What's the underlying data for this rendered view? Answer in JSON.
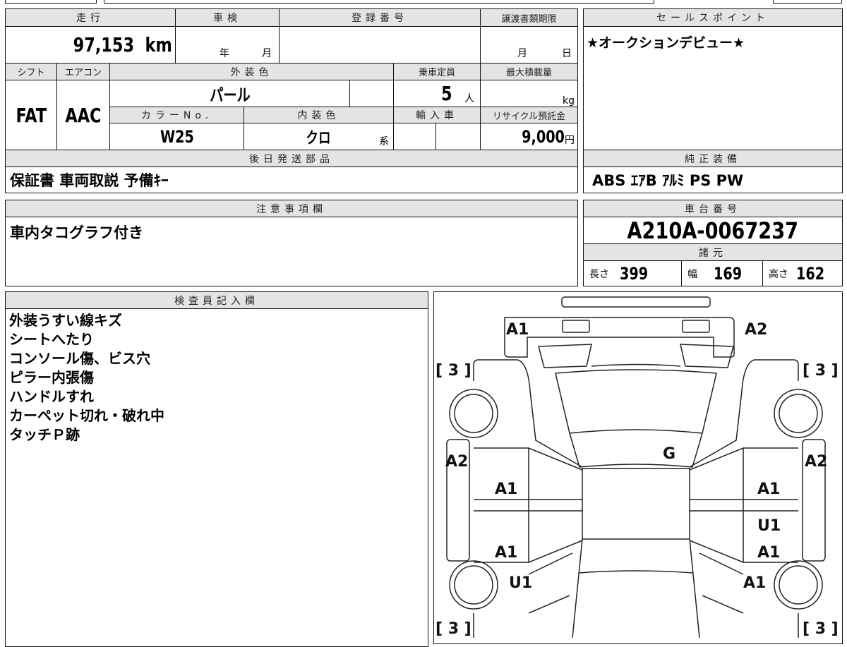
{
  "vehicle": {
    "mileage_label": "走行",
    "mileage": "97,153",
    "mileage_unit": "km",
    "inspection_label": "車検",
    "inspection_year": "年",
    "inspection_month": "月",
    "registration_label": "登録番号",
    "transfer_deadline_label": "譲渡書類期限",
    "transfer_month": "月",
    "transfer_day": "日",
    "shift_label": "シフト",
    "shift": "FAT",
    "aircon_label": "エアコン",
    "aircon": "AAC",
    "exterior_color_label": "外装色",
    "exterior_color": "パール",
    "capacity_label": "乗車定員",
    "capacity": "5",
    "capacity_unit": "人",
    "max_load_label": "最大積載量",
    "max_load_unit": "kg",
    "color_no_label": "カラーNo.",
    "color_no": "W25",
    "interior_color_label": "内装色",
    "interior_color": "クロ",
    "interior_suffix": "系",
    "import_label": "輸入車",
    "recycle_label": "リサイクル預託金",
    "recycle_fee": "9,000",
    "recycle_unit": "円"
  },
  "later_parts": {
    "label": "後日発送部品",
    "value": "保証書 車両取説 予備ｷｰ"
  },
  "sales_point": {
    "label": "セールスポイント",
    "value": "★オークションデビュー★"
  },
  "equipment": {
    "label": "純正装備",
    "value": "ABS ｴｱB ｱﾙﾐ PS PW"
  },
  "notes": {
    "label": "注意事項欄",
    "value": "車内タコグラフ付き"
  },
  "chassis": {
    "label": "車台番号",
    "value": "A210A-0067237"
  },
  "specs": {
    "label": "諸元",
    "length_label": "長さ",
    "length": "399",
    "width_label": "幅",
    "width": "169",
    "height_label": "高さ",
    "height": "162"
  },
  "inspector": {
    "label": "検査員記入欄",
    "lines": [
      "外装うすい線キズ",
      "シートへたり",
      "コンソール傷、ビス穴",
      "ピラー内張傷",
      "ハンドルすれ",
      "カーペット切れ・破れ中",
      "タッチＰ跡"
    ]
  },
  "diagram": {
    "marks": {
      "rear_left": "A1",
      "rear_right": "A2",
      "left_sill": "A2",
      "right_sill": "A2",
      "roof": "G",
      "left_rear_door": "A1",
      "right_rear_door": "A1",
      "right_door_u": "U1",
      "left_front_door": "A1",
      "right_front_door": "A1",
      "left_fender": "U1",
      "right_fender": "A1"
    },
    "tires": [
      "[ 3 ]",
      "[ 3 ]",
      "[ 3 ]",
      "[ 3 ]"
    ]
  }
}
